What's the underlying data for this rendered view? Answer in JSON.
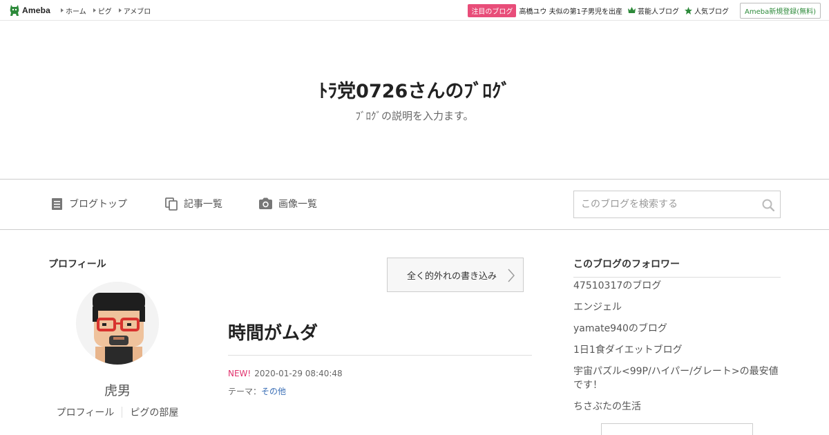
{
  "topbar": {
    "logo_text": "Ameba",
    "nav": [
      {
        "label": "ホーム"
      },
      {
        "label": "ピグ"
      },
      {
        "label": "アメブロ"
      }
    ],
    "pickup_badge": "注目のブログ",
    "pickup_text": "高橋ユウ 夫似の第1子男児を出産",
    "links": [
      {
        "label": "芸能人ブログ",
        "icon": "crown-icon"
      },
      {
        "label": "人気ブログ",
        "icon": "star-icon"
      }
    ],
    "signup_label": "Ameba新規登録(無料)",
    "brand_color": "#2d8a3a",
    "badge_color": "#e84d79"
  },
  "header": {
    "title": "ﾄﾗ党0726さんのﾌﾞﾛｸﾞ",
    "description": "ﾌﾞﾛｸﾞの説明を入力ます。"
  },
  "nav": {
    "items": [
      {
        "label": "ブログトップ",
        "icon": "document-icon"
      },
      {
        "label": "記事一覧",
        "icon": "copy-icon"
      },
      {
        "label": "画像一覧",
        "icon": "camera-icon"
      }
    ],
    "search_placeholder": "このブログを検索する"
  },
  "sidebar_left": {
    "heading": "プロフィール",
    "name": "虎男",
    "links": [
      "プロフィール",
      "ピグの部屋"
    ]
  },
  "main": {
    "prev_entry_label": "全く的外れの書き込み",
    "entry_title": "時間がムダ",
    "new_label": "NEW!",
    "date": "2020-01-29 08:40:48",
    "theme_label": "テーマ：",
    "theme_value": "その他",
    "new_color": "#e0306c",
    "link_color": "#3b6fb6"
  },
  "sidebar_right": {
    "heading": "このブログのフォロワー",
    "followers": [
      "47510317のブログ",
      "エンジェル",
      "yamate940のブログ",
      "1日1食ダイエットブログ",
      "宇宙パズル<99P/ハイパー/グレート>の最安値です！",
      "ちさぶたの生活"
    ]
  }
}
